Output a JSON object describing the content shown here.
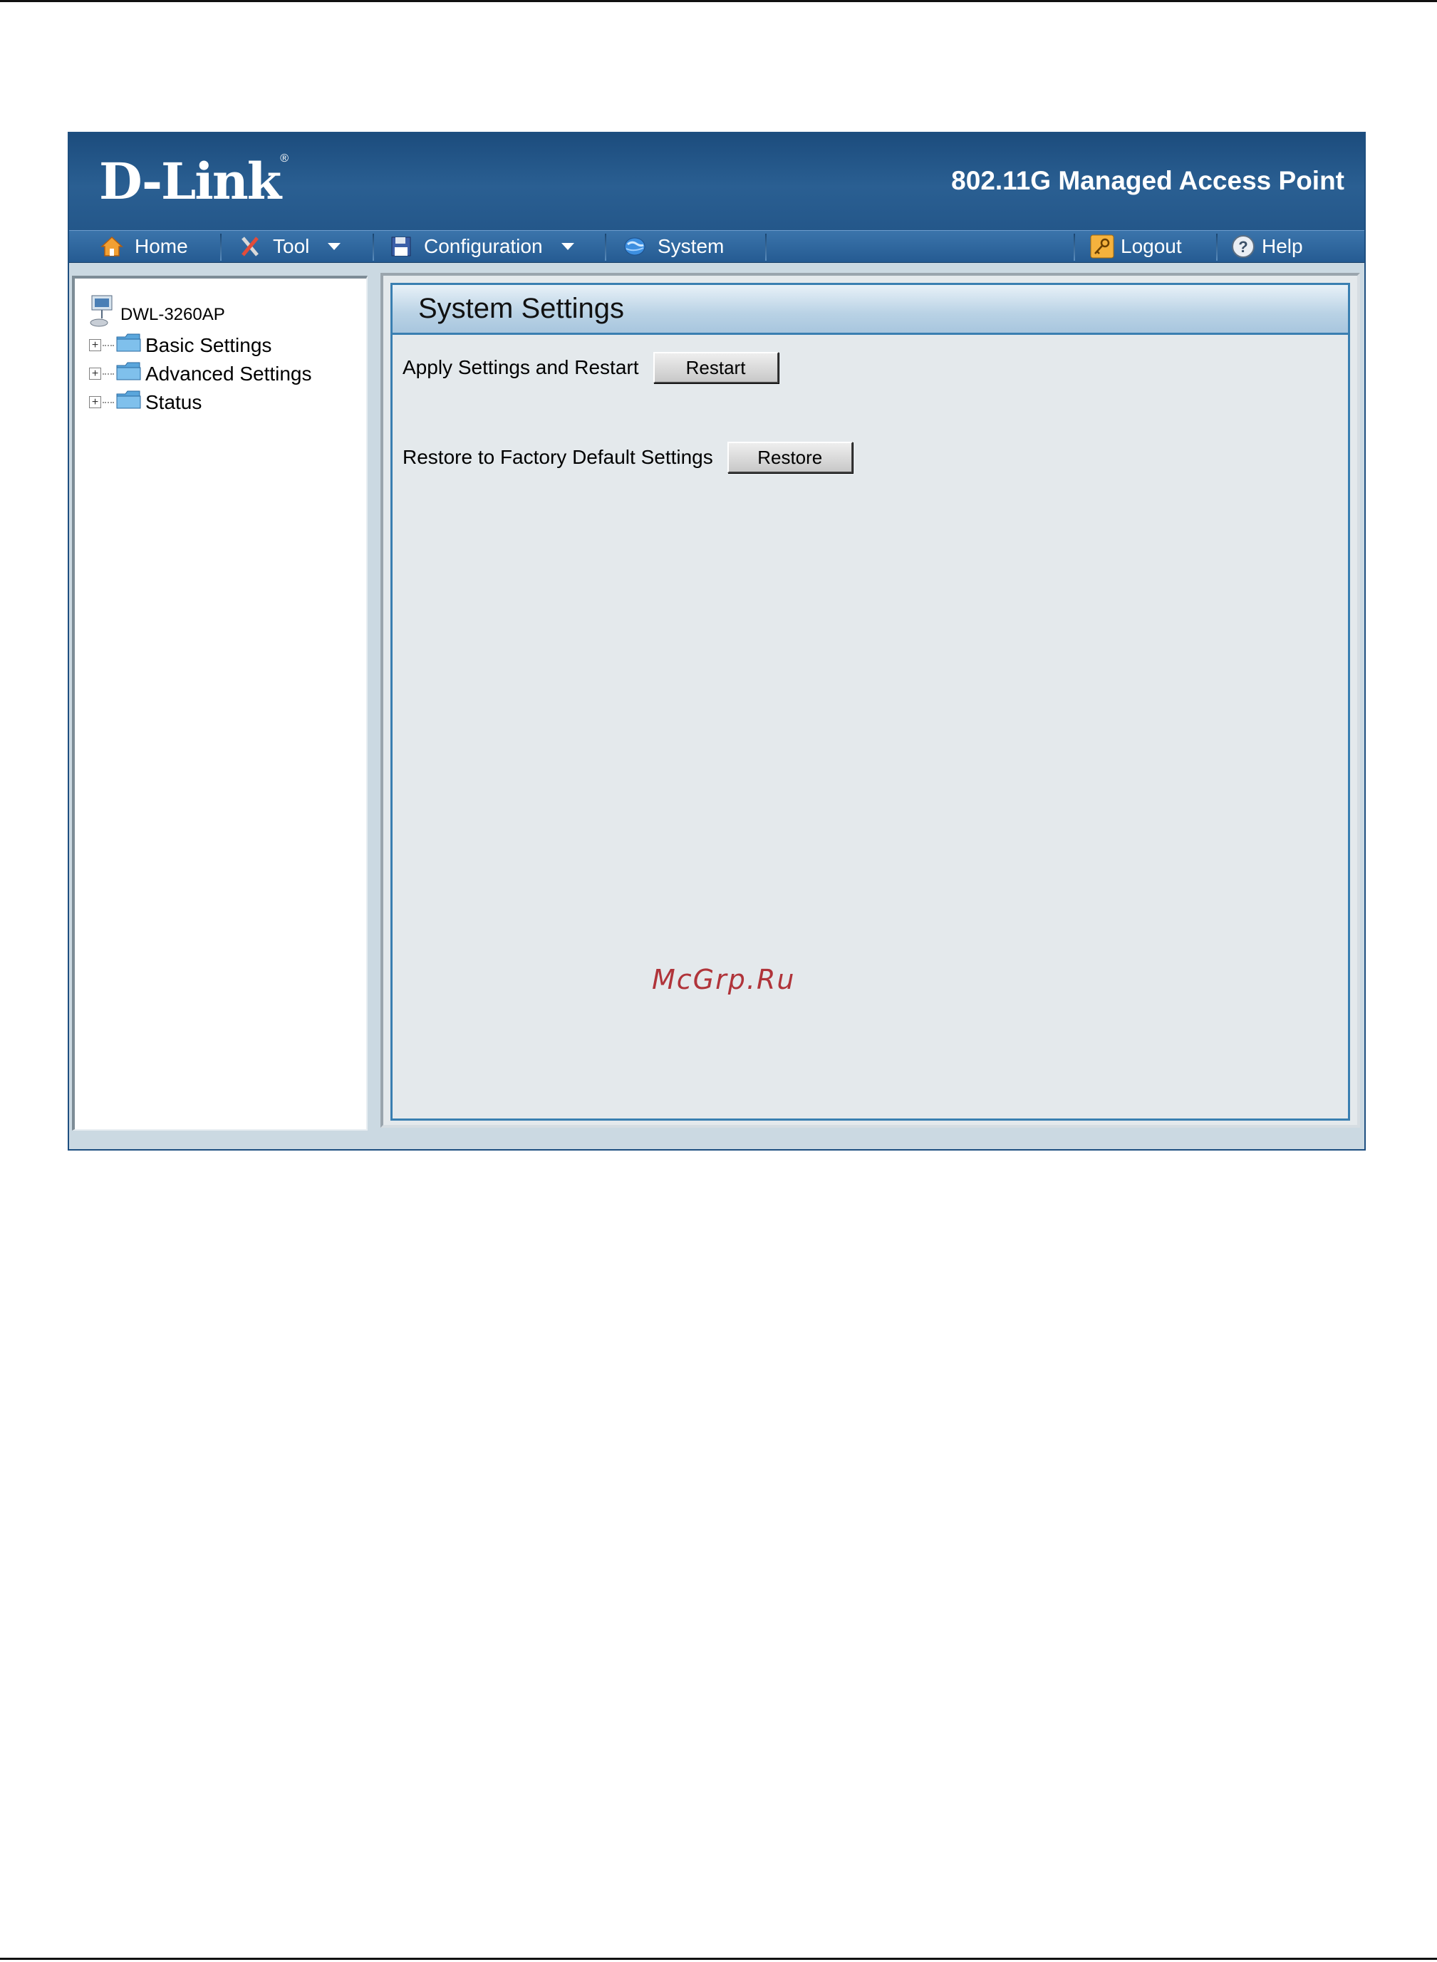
{
  "header": {
    "brand": "D-Link",
    "brand_mark": "®",
    "product_title": "802.11G Managed Access Point"
  },
  "nav": {
    "home": "Home",
    "tool": "Tool",
    "configuration": "Configuration",
    "system": "System",
    "logout": "Logout",
    "help": "Help"
  },
  "tree": {
    "root": "DWL-3260AP",
    "items": [
      {
        "label": "Basic Settings"
      },
      {
        "label": "Advanced Settings"
      },
      {
        "label": "Status"
      }
    ]
  },
  "main": {
    "title": "System Settings",
    "restart": {
      "label": "Apply Settings and Restart",
      "button": "Restart"
    },
    "restore": {
      "label": "Restore to Factory Default Settings",
      "button": "Restore"
    }
  },
  "watermark": "McGrp.Ru"
}
